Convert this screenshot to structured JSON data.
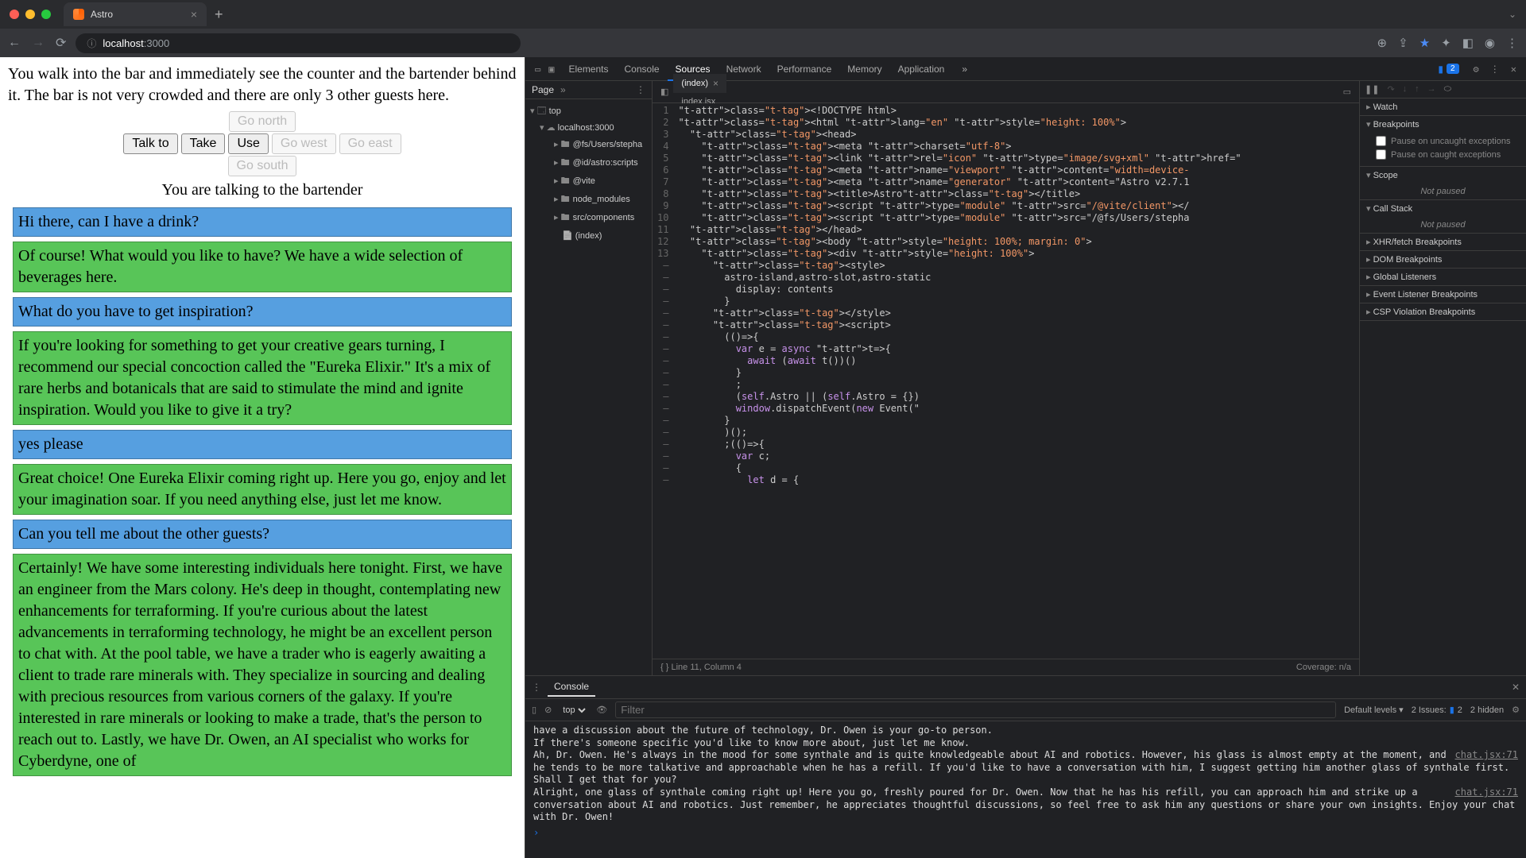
{
  "browser": {
    "tab_title": "Astro",
    "url_host": "localhost",
    "url_port": ":3000"
  },
  "game": {
    "description": "You walk into the bar and immediately see the counter and the bartender behind it. The bar is not very crowded and there are only 3 other guests here.",
    "buttons": {
      "talk_to": "Talk to",
      "take": "Take",
      "use": "Use",
      "go_north": "Go north",
      "go_west": "Go west",
      "go_east": "Go east",
      "go_south": "Go south"
    },
    "status": "You are talking to the bartender",
    "messages": [
      {
        "role": "user",
        "text": "Hi there, can I have a drink?"
      },
      {
        "role": "bot",
        "text": "Of course! What would you like to have? We have a wide selection of beverages here."
      },
      {
        "role": "user",
        "text": "What do you have to get inspiration?"
      },
      {
        "role": "bot",
        "text": "If you're looking for something to get your creative gears turning, I recommend our special concoction called the \"Eureka Elixir.\" It's a mix of rare herbs and botanicals that are said to stimulate the mind and ignite inspiration. Would you like to give it a try?"
      },
      {
        "role": "user",
        "text": "yes please"
      },
      {
        "role": "bot",
        "text": "Great choice! One Eureka Elixir coming right up. Here you go, enjoy and let your imagination soar. If you need anything else, just let me know."
      },
      {
        "role": "user",
        "text": "Can you tell me about the other guests?"
      },
      {
        "role": "bot",
        "text": "Certainly! We have some interesting individuals here tonight. First, we have an engineer from the Mars colony. He's deep in thought, contemplating new enhancements for terraforming. If you're curious about the latest advancements in terraforming technology, he might be an excellent person to chat with. At the pool table, we have a trader who is eagerly awaiting a client to trade rare minerals with. They specialize in sourcing and dealing with precious resources from various corners of the galaxy. If you're interested in rare minerals or looking to make a trade, that's the person to reach out to. Lastly, we have Dr. Owen, an AI specialist who works for Cyberdyne, one of"
      }
    ]
  },
  "devtools": {
    "tabs": [
      "Elements",
      "Console",
      "Sources",
      "Network",
      "Performance",
      "Memory",
      "Application"
    ],
    "active_tab": "Sources",
    "badge_count": "2",
    "nav": {
      "page_label": "Page"
    },
    "tree": {
      "top": "top",
      "host": "localhost:3000",
      "folders": [
        "@fs/Users/stepha",
        "@id/astro:scripts",
        "@vite",
        "node_modules",
        "src/components"
      ],
      "file": "(index)"
    },
    "editor": {
      "tabs": [
        {
          "name": "(index)",
          "active": true
        },
        {
          "name": "index.jsx",
          "active": false
        }
      ],
      "lines": [
        "<!DOCTYPE html>",
        "<html lang=\"en\" style=\"height: 100%\">",
        "  <head>",
        "    <meta charset=\"utf-8\">",
        "    <link rel=\"icon\" type=\"image/svg+xml\" href=\"",
        "    <meta name=\"viewport\" content=\"width=device-",
        "    <meta name=\"generator\" content=\"Astro v2.7.1",
        "    <title>Astro</title>",
        "    <script type=\"module\" src=\"/@vite/client\"></",
        "    <script type=\"module\" src=\"/@fs/Users/stepha",
        "  </head>",
        "  <body style=\"height: 100%; margin: 0\">",
        "    <div style=\"height: 100%\">",
        "      <style>",
        "        astro-island,astro-slot,astro-static",
        "          display: contents",
        "        }",
        "      </style>",
        "      <script>",
        "        (()=>{",
        "          var e = async t=>{",
        "            await (await t())()",
        "          }",
        "          ;",
        "          (self.Astro || (self.Astro = {})",
        "          window.dispatchEvent(new Event(\"",
        "        }",
        "        )();",
        "        ;(()=>{",
        "          var c;",
        "          {",
        "            let d = {"
      ],
      "gutter": [
        "1",
        "2",
        "3",
        "4",
        "5",
        "6",
        "7",
        "8",
        "9",
        "10",
        "11",
        "12",
        "13",
        "–",
        "–",
        "–",
        "–",
        "–",
        "–",
        "–",
        "–",
        "–",
        "–",
        "–",
        "–",
        "–",
        "–",
        "–",
        "–",
        "–",
        "–",
        "–"
      ],
      "status_left": "{ }  Line 11, Column 4",
      "status_right": "Coverage: n/a"
    },
    "debugger": {
      "sections": [
        "Watch",
        "Breakpoints",
        "Scope",
        "Call Stack",
        "XHR/fetch Breakpoints",
        "DOM Breakpoints",
        "Global Listeners",
        "Event Listener Breakpoints",
        "CSP Violation Breakpoints"
      ],
      "break_uncaught": "Pause on uncaught exceptions",
      "break_caught": "Pause on caught exceptions",
      "not_paused": "Not paused"
    },
    "console": {
      "tab": "Console",
      "context": "top",
      "filter_placeholder": "Filter",
      "levels": "Default levels ▾",
      "issues": "2 Issues:",
      "issues_badge": "2",
      "hidden": "2 hidden",
      "logs": [
        {
          "src": "",
          "text": "have a discussion about the future of technology, Dr. Owen is your go-to person."
        },
        {
          "src": "",
          "text": "If there's someone specific you'd like to know more about, just let me know."
        },
        {
          "src": "chat.jsx:71",
          "text": "Ah, Dr. Owen. He's always in the mood for some synthale and is quite knowledgeable about AI and robotics. However, his glass is almost empty at the moment, and he tends to be more talkative and approachable when he has a refill. If you'd like to have a conversation with him, I suggest getting him another glass of synthale first. Shall I get that for you?"
        },
        {
          "src": "chat.jsx:71",
          "text": "Alright, one glass of synthale coming right up! Here you go, freshly poured for Dr. Owen. Now that he has his refill, you can approach him and strike up a conversation about AI and robotics. Just remember, he appreciates thoughtful discussions, so feel free to ask him any questions or share your own insights. Enjoy your chat with Dr. Owen!"
        }
      ]
    }
  }
}
